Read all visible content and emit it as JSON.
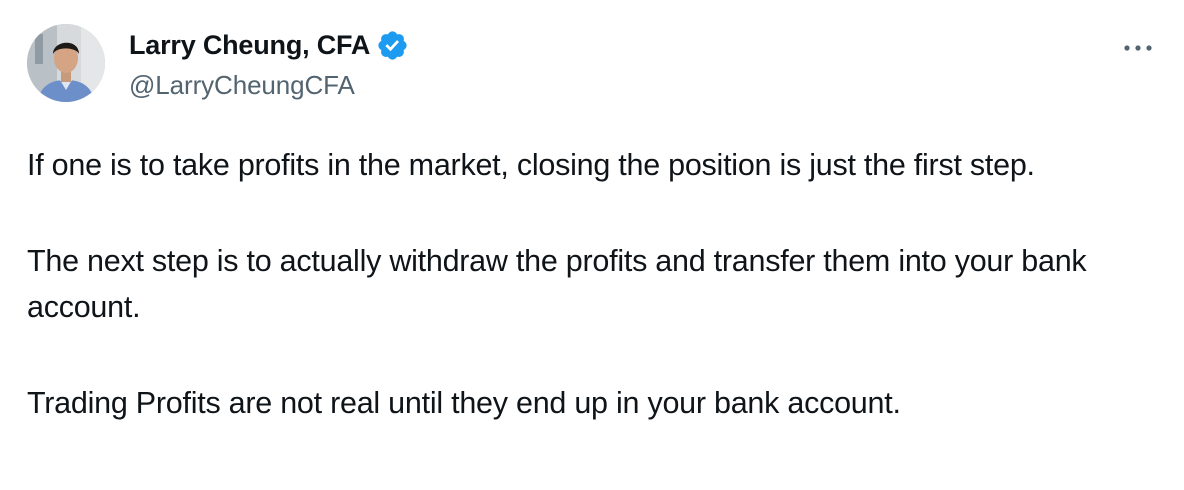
{
  "author": {
    "name": "Larry Cheung, CFA",
    "handle": "@LarryCheungCFA",
    "verified": true,
    "verified_color": "#1d9bf0"
  },
  "actions": {
    "more_icon": "ellipsis-horizontal-icon"
  },
  "tweet": {
    "paragraphs": [
      "If one is to take profits in the market, closing the position is just the first step.",
      "The next step is to actually withdraw the profits and transfer them into your bank account.",
      "Trading Profits are not real until they end up in your bank account."
    ]
  },
  "colors": {
    "text": "#0f1419",
    "secondary_text": "#536471",
    "accent": "#1d9bf0"
  }
}
